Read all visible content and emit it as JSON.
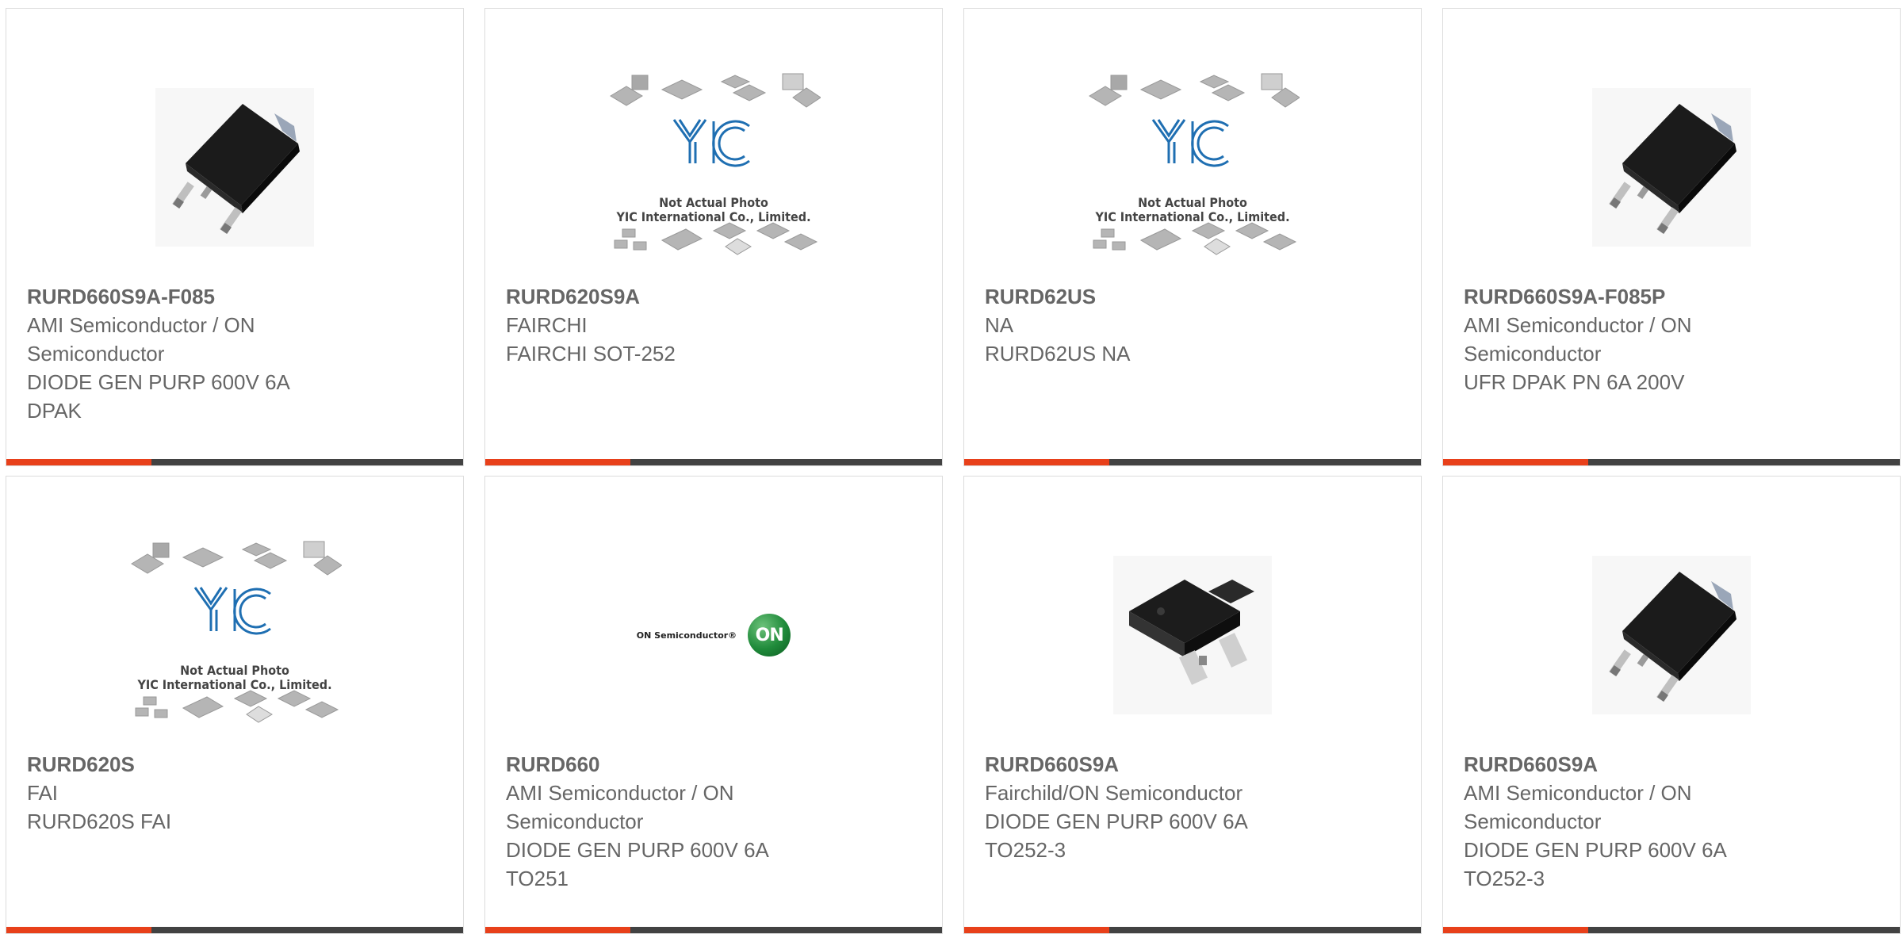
{
  "products": [
    {
      "part": "RURD660S9A-F085",
      "lines": [
        "AMI Semiconductor / ON",
        "Semiconductor",
        "DIODE GEN PURP 600V 6A",
        "DPAK"
      ],
      "image": "dpak-package"
    },
    {
      "part": "RURD620S9A",
      "lines": [
        "FAIRCHI",
        "FAIRCHI SOT-252"
      ],
      "image": "placeholder",
      "placeholder": {
        "line1": "Not Actual Photo",
        "line2": "YIC International Co., Limited.",
        "logo": "YIC"
      }
    },
    {
      "part": "RURD62US",
      "lines": [
        "NA",
        "RURD62US NA"
      ],
      "image": "placeholder",
      "placeholder": {
        "line1": "Not Actual Photo",
        "line2": "YIC International Co., Limited.",
        "logo": "YIC"
      }
    },
    {
      "part": "RURD660S9A-F085P",
      "lines": [
        "AMI Semiconductor / ON",
        "Semiconductor",
        "UFR DPAK PN 6A 200V"
      ],
      "image": "dpak-package"
    },
    {
      "part": "RURD620S",
      "lines": [
        "FAI",
        "RURD620S FAI"
      ],
      "image": "placeholder",
      "placeholder": {
        "line1": "Not Actual Photo",
        "line2": "YIC International Co., Limited.",
        "logo": "YIC"
      }
    },
    {
      "part": "RURD660",
      "lines": [
        "AMI Semiconductor / ON",
        "Semiconductor",
        "DIODE GEN PURP 600V 6A",
        "TO251"
      ],
      "image": "on-semiconductor-logo",
      "logo": {
        "text": "ON Semiconductor®",
        "mark": "ON"
      }
    },
    {
      "part": "RURD660S9A",
      "lines": [
        "Fairchild/ON Semiconductor",
        "DIODE GEN PURP 600V 6A",
        "TO252-3"
      ],
      "image": "to252-package"
    },
    {
      "part": "RURD660S9A",
      "lines": [
        "AMI Semiconductor / ON",
        "Semiconductor",
        "DIODE GEN PURP 600V 6A",
        "TO252-3"
      ],
      "image": "dpak-package"
    }
  ],
  "colors": {
    "accent": "#e8401a",
    "bar": "#424242",
    "text": "#666666",
    "yic_blue": "#1f6fb2"
  }
}
